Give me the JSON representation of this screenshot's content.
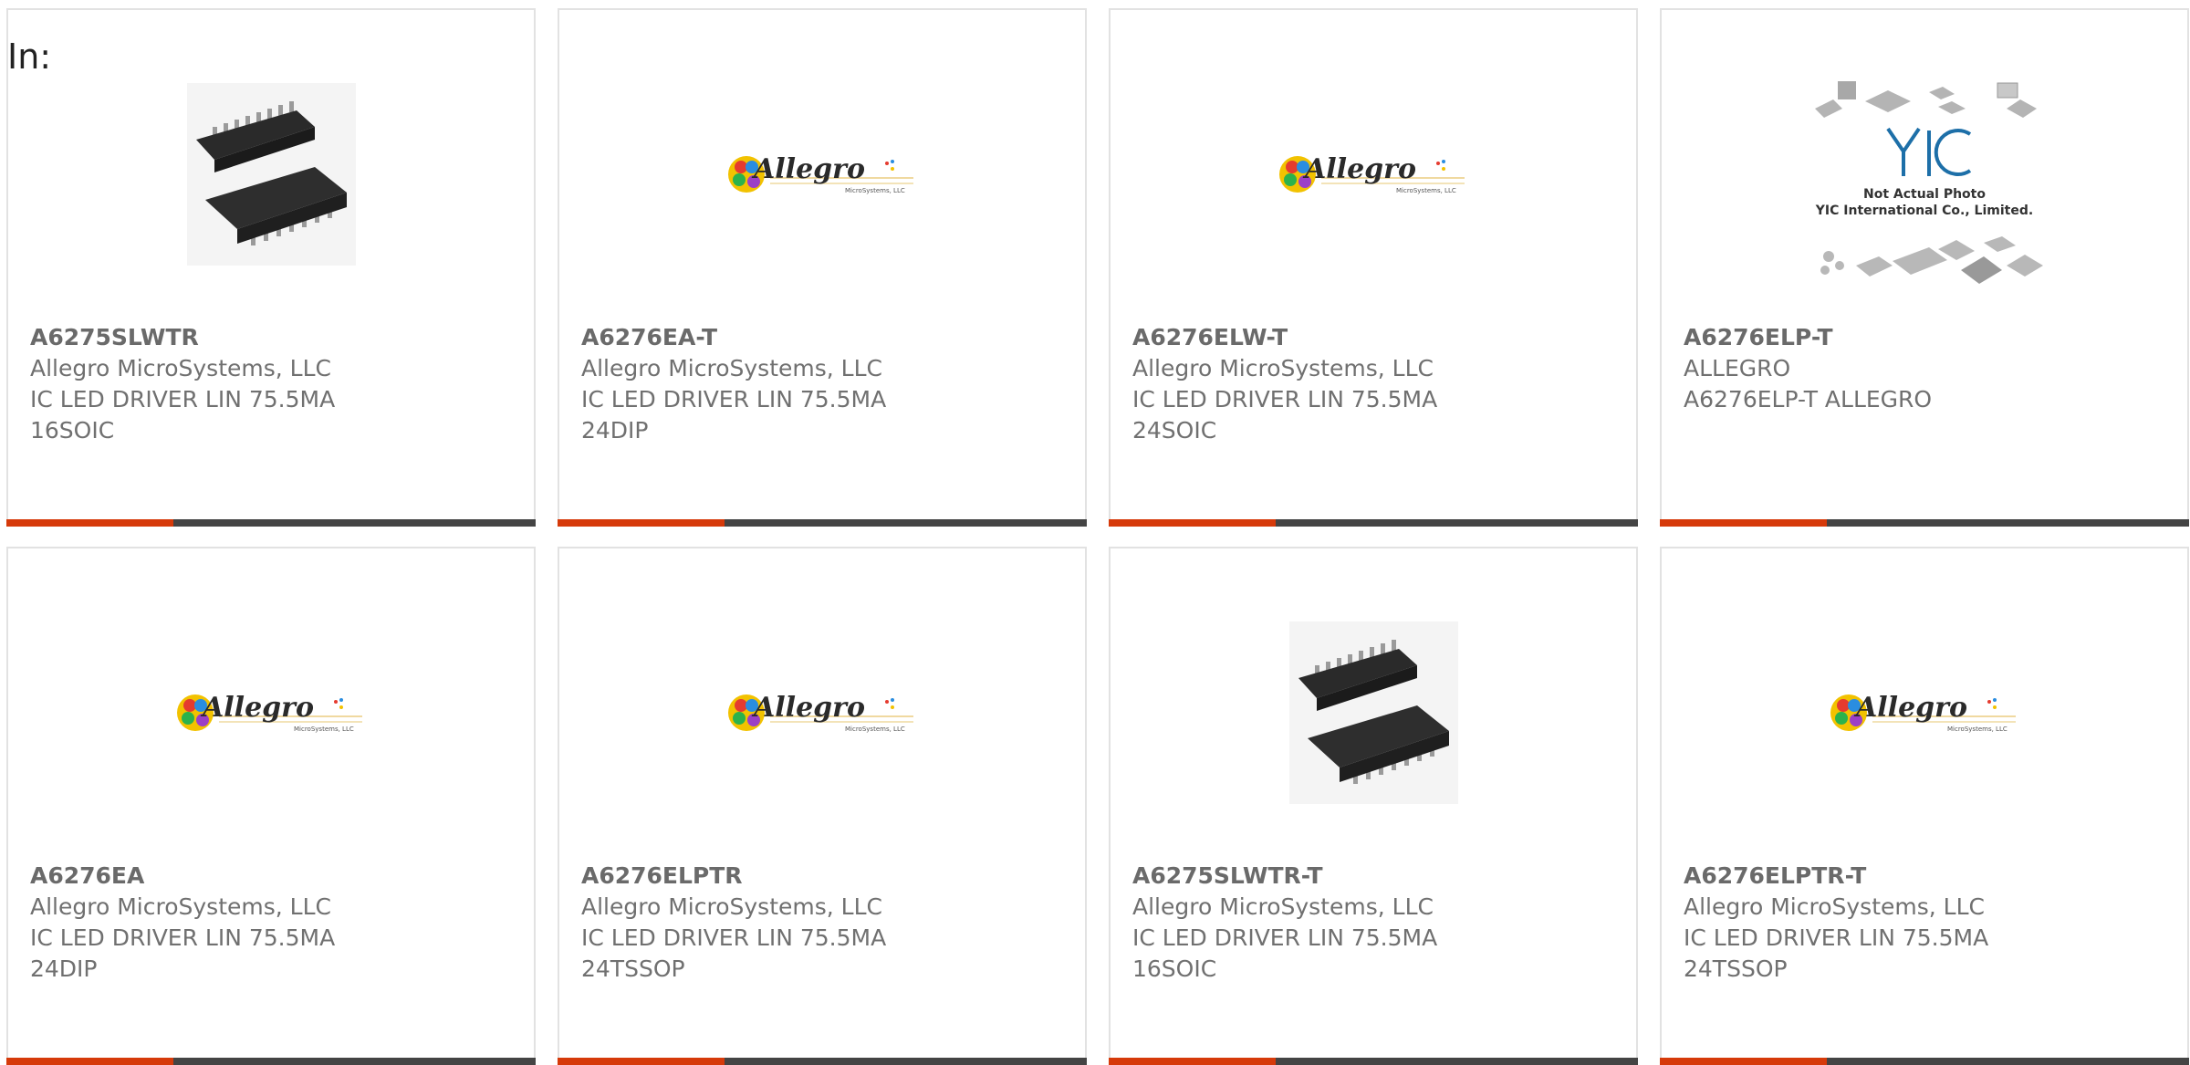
{
  "header": {
    "in_label": "In:"
  },
  "cards": [
    {
      "part": "A6275SLWTR",
      "line1": "Allegro MicroSystems, LLC",
      "line2": "IC LED DRIVER LIN 75.5MA",
      "line3": "16SOIC",
      "image": "chip-soic"
    },
    {
      "part": "A6276EA-T",
      "line1": "Allegro MicroSystems, LLC",
      "line2": "IC LED DRIVER LIN 75.5MA",
      "line3": "24DIP",
      "image": "allegro-logo"
    },
    {
      "part": "A6276ELW-T",
      "line1": "Allegro MicroSystems, LLC",
      "line2": "IC LED DRIVER LIN 75.5MA",
      "line3": "24SOIC",
      "image": "allegro-logo"
    },
    {
      "part": "A6276ELP-T",
      "line1": "ALLEGRO",
      "line2": "A6276ELP-T ALLEGRO",
      "line3": "",
      "image": "yic-placeholder"
    },
    {
      "part": "A6276EA",
      "line1": "Allegro MicroSystems, LLC",
      "line2": "IC LED DRIVER LIN 75.5MA",
      "line3": "24DIP",
      "image": "allegro-logo"
    },
    {
      "part": "A6276ELPTR",
      "line1": "Allegro MicroSystems, LLC",
      "line2": "IC LED DRIVER LIN 75.5MA",
      "line3": "24TSSOP",
      "image": "allegro-logo"
    },
    {
      "part": "A6275SLWTR-T",
      "line1": "Allegro MicroSystems, LLC",
      "line2": "IC LED DRIVER LIN 75.5MA",
      "line3": "16SOIC",
      "image": "chip-soic"
    },
    {
      "part": "A6276ELPTR-T",
      "line1": "Allegro MicroSystems, LLC",
      "line2": "IC LED DRIVER LIN 75.5MA",
      "line3": "24TSSOP",
      "image": "allegro-logo"
    }
  ],
  "logos": {
    "allegro": {
      "word": "Allegro",
      "sub": "MicroSystems, LLC"
    },
    "yic": {
      "mark": "YIC",
      "line1": "Not Actual Photo",
      "line2": "YIC International Co., Limited."
    }
  },
  "colors": {
    "accent": "#d63a0a",
    "bar": "#444444",
    "text": "#707070"
  }
}
